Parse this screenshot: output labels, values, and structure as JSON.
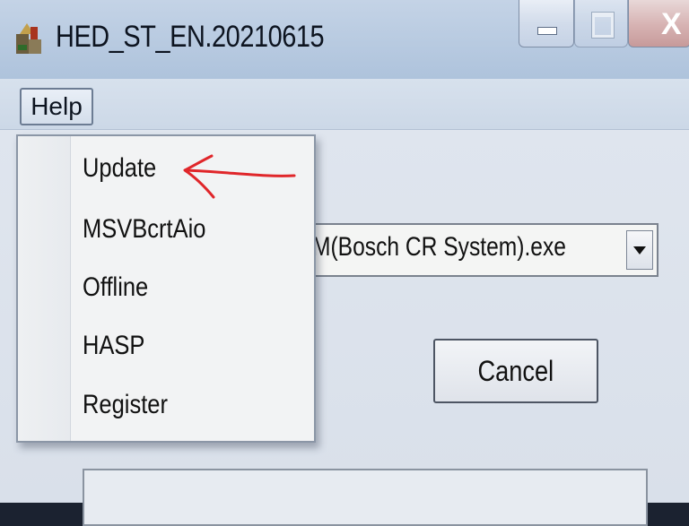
{
  "window": {
    "title": "HED_ST_EN.20210615",
    "icons": {
      "app": "app-icon",
      "minimize": "minimize-icon",
      "maximize": "maximize-icon",
      "close": "close-icon"
    },
    "close_glyph": "X"
  },
  "menubar": {
    "items": [
      {
        "label": "Help"
      }
    ]
  },
  "help_menu": {
    "items": [
      {
        "label": "Update"
      },
      {
        "label": "MSVBcrtAio"
      },
      {
        "label": "Offline"
      },
      {
        "label": "HASP"
      },
      {
        "label": "Register"
      }
    ]
  },
  "main": {
    "program_select": {
      "value": "M(Bosch CR System).exe"
    },
    "cancel_label": "Cancel"
  },
  "annotation": {
    "color": "#e0262a"
  }
}
